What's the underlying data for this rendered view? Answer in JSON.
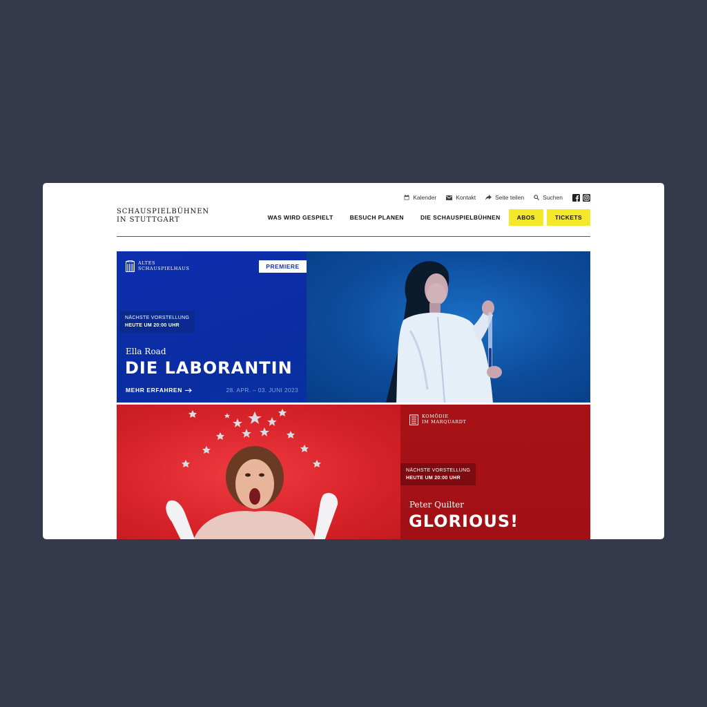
{
  "utility_nav": {
    "calendar": "Kalender",
    "contact": "Kontakt",
    "share": "Seite teilen",
    "search": "Suchen"
  },
  "logo": {
    "line1": "SCHAUSPIELBÜHNEN",
    "line2": "IN STUTTGART"
  },
  "main_nav": {
    "items": [
      "WAS WIRD GESPIELT",
      "BESUCH PLANEN",
      "DIE SCHAUSPIELBÜHNEN"
    ],
    "abos": "ABOS",
    "tickets": "TICKETS"
  },
  "colors": {
    "accent_yellow": "#f4e82a",
    "card1_blue": "#0d2fb0",
    "card2_red": "#a81217"
  },
  "cards": [
    {
      "venue_line1": "ALTES",
      "venue_line2": "SCHAUSPIELHAUS",
      "badge": "PREMIERE",
      "next_label": "NÄCHSTE VORSTELLUNG",
      "next_time": "HEUTE UM 20:00 UHR",
      "author": "Ella Road",
      "title": "DIE LABORANTIN",
      "more": "MEHR ERFAHREN",
      "dates": "28. APR. – 03. JUNI 2023"
    },
    {
      "venue_line1": "KOMÖDIE",
      "venue_line2": "IM MARQUARDT",
      "next_label": "NÄCHSTE VORSTELLUNG",
      "next_time": "HEUTE UM 20:00 UHR",
      "author": "Peter Quilter",
      "title": "GLORIOUS!"
    }
  ]
}
